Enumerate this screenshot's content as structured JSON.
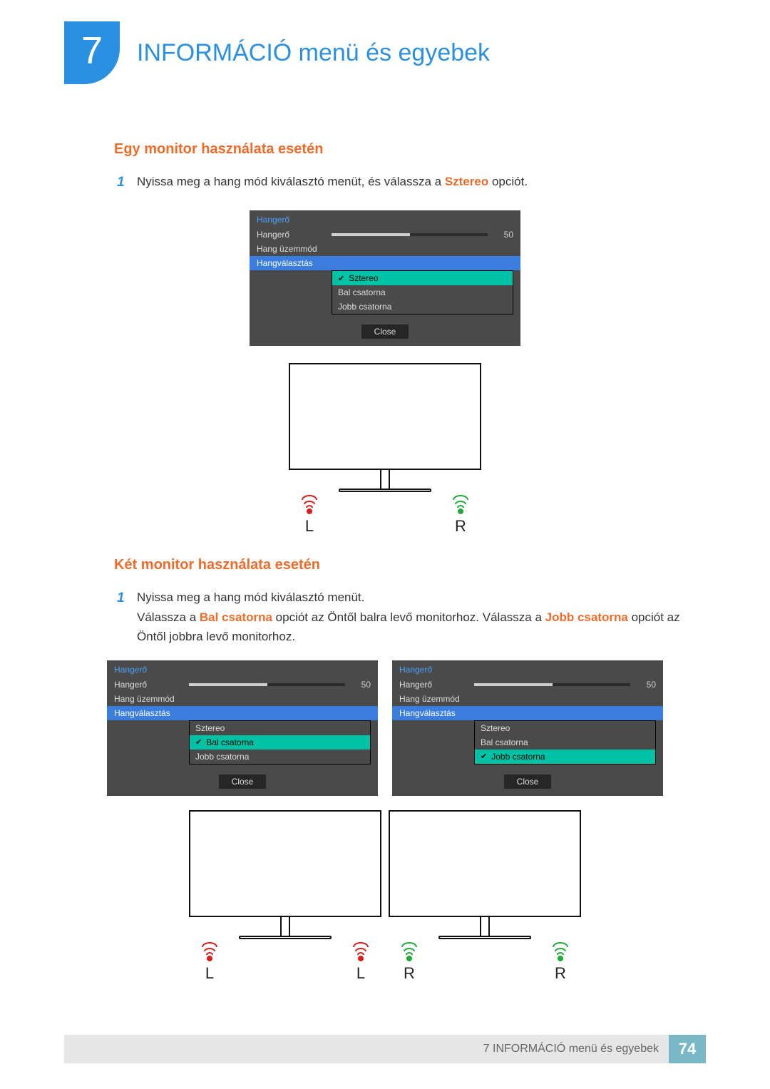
{
  "chapter": {
    "number": "7",
    "title": "INFORMÁCIÓ menü és egyebek"
  },
  "section1": {
    "heading": "Egy monitor használata esetén",
    "step_num": "1",
    "step_before": "Nyissa meg a hang mód kiválasztó menüt, és válassza a ",
    "step_hl": "Sztereo",
    "step_after": " opciót."
  },
  "section2": {
    "heading": "Két monitor használata esetén",
    "step_num": "1",
    "step_line1": "Nyissa meg a hang mód kiválasztó menüt.",
    "step_line2a": "Válassza a ",
    "step_line2_hl1": "Bal csatorna",
    "step_line2b": " opciót az Öntől balra levő monitorhoz. Válassza a ",
    "step_line2_hl2": "Jobb csatorna",
    "step_line2c": " opciót az Öntől jobbra levő monitorhoz."
  },
  "osd": {
    "title": "Hangerő",
    "volume_label": "Hangerő",
    "volume_value": "50",
    "mode_label": "Hang üzemmód",
    "select_label": "Hangválasztás",
    "opt_stereo": "Sztereo",
    "opt_left": "Bal csatorna",
    "opt_right": "Jobb csatorna",
    "close": "Close"
  },
  "speakers": {
    "L": "L",
    "R": "R"
  },
  "footer": {
    "text": "7 INFORMÁCIÓ menü és egyebek",
    "page": "74"
  }
}
